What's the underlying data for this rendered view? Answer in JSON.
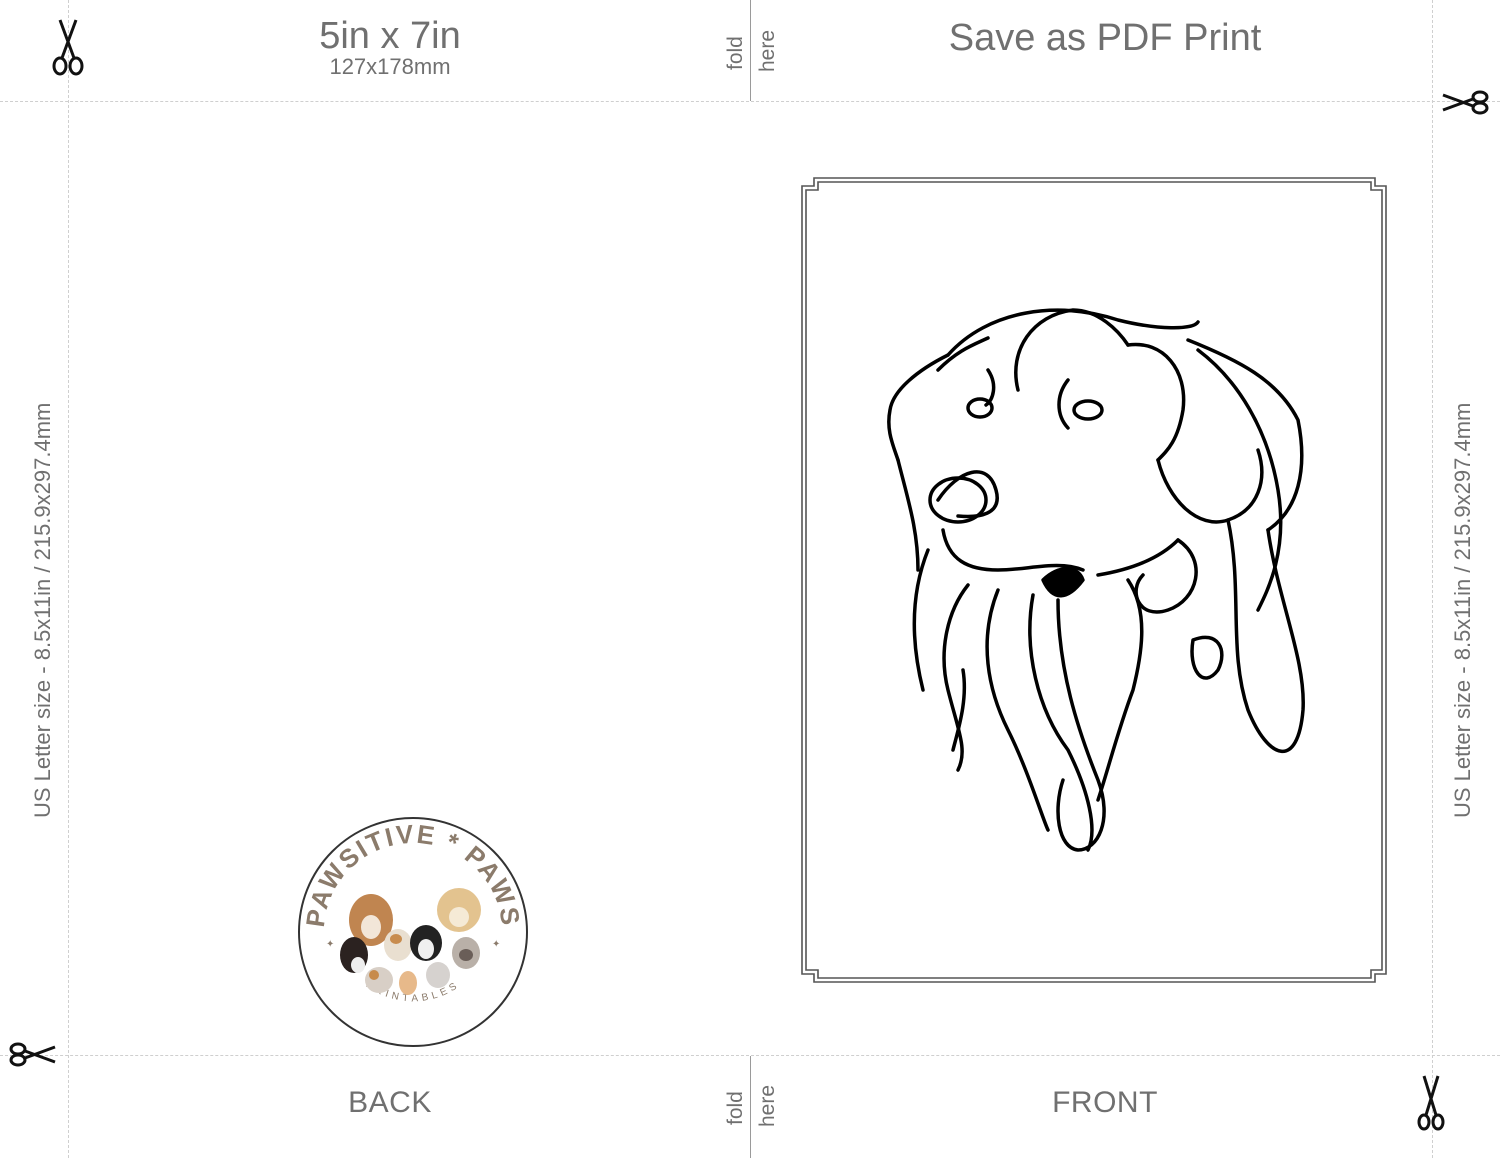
{
  "header": {
    "size_title": "5in x 7in",
    "size_subtitle": "127x178mm",
    "print_title": "Save as PDF Print"
  },
  "fold": {
    "word1": "fold",
    "word2": "here"
  },
  "side_label": "US Letter size - 8.5x11in / 215.9x297.4mm",
  "footer": {
    "back_label": "BACK",
    "front_label": "FRONT"
  },
  "logo": {
    "top_text": "PAWSITIVE * PAWS",
    "bottom_text": "PRINTABLES",
    "text_color": "#8b7b6b"
  },
  "icons": {
    "cut": "scissors-icon"
  }
}
